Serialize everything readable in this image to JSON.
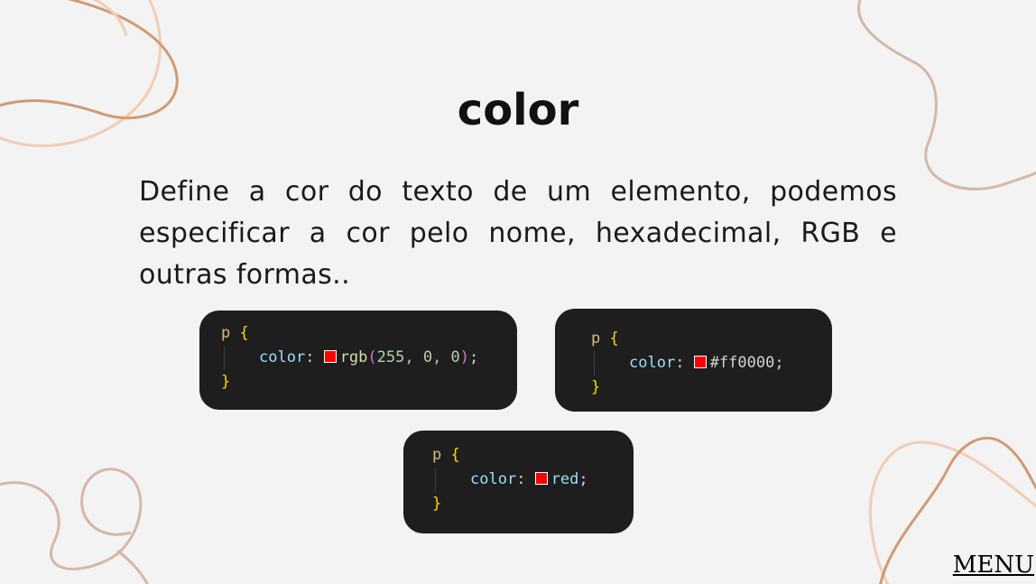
{
  "slide": {
    "title": "color",
    "description": "Define a cor do texto de um elemento, podemos especificar a cor pelo nome, hexadecimal, RGB e outras formas.."
  },
  "code_examples": {
    "rgb": {
      "selector": "p",
      "open_brace": "{",
      "property": "color",
      "colon": ":",
      "function_name": "rgb",
      "open_paren": "(",
      "arguments": "255, 0, 0",
      "close_paren": ")",
      "semicolon": ";",
      "close_brace": "}",
      "swatch_color": "#ff0000"
    },
    "hex": {
      "selector": "p",
      "open_brace": "{",
      "property": "color",
      "colon": ":",
      "value": "#ff0000",
      "semicolon": ";",
      "close_brace": "}",
      "swatch_color": "#ff0000"
    },
    "name": {
      "selector": "p",
      "open_brace": "{",
      "property": "color",
      "colon": ":",
      "value": "red",
      "semicolon": ";",
      "close_brace": "}",
      "swatch_color": "#ff0000"
    }
  },
  "navigation": {
    "menu_label": "MENU"
  },
  "colors": {
    "background": "#f3f3f3",
    "code_background": "#1e1e1e",
    "decor_brown": "#d09a74",
    "decor_peach": "#f2cdb3",
    "decor_tan": "#d6b7a6"
  }
}
